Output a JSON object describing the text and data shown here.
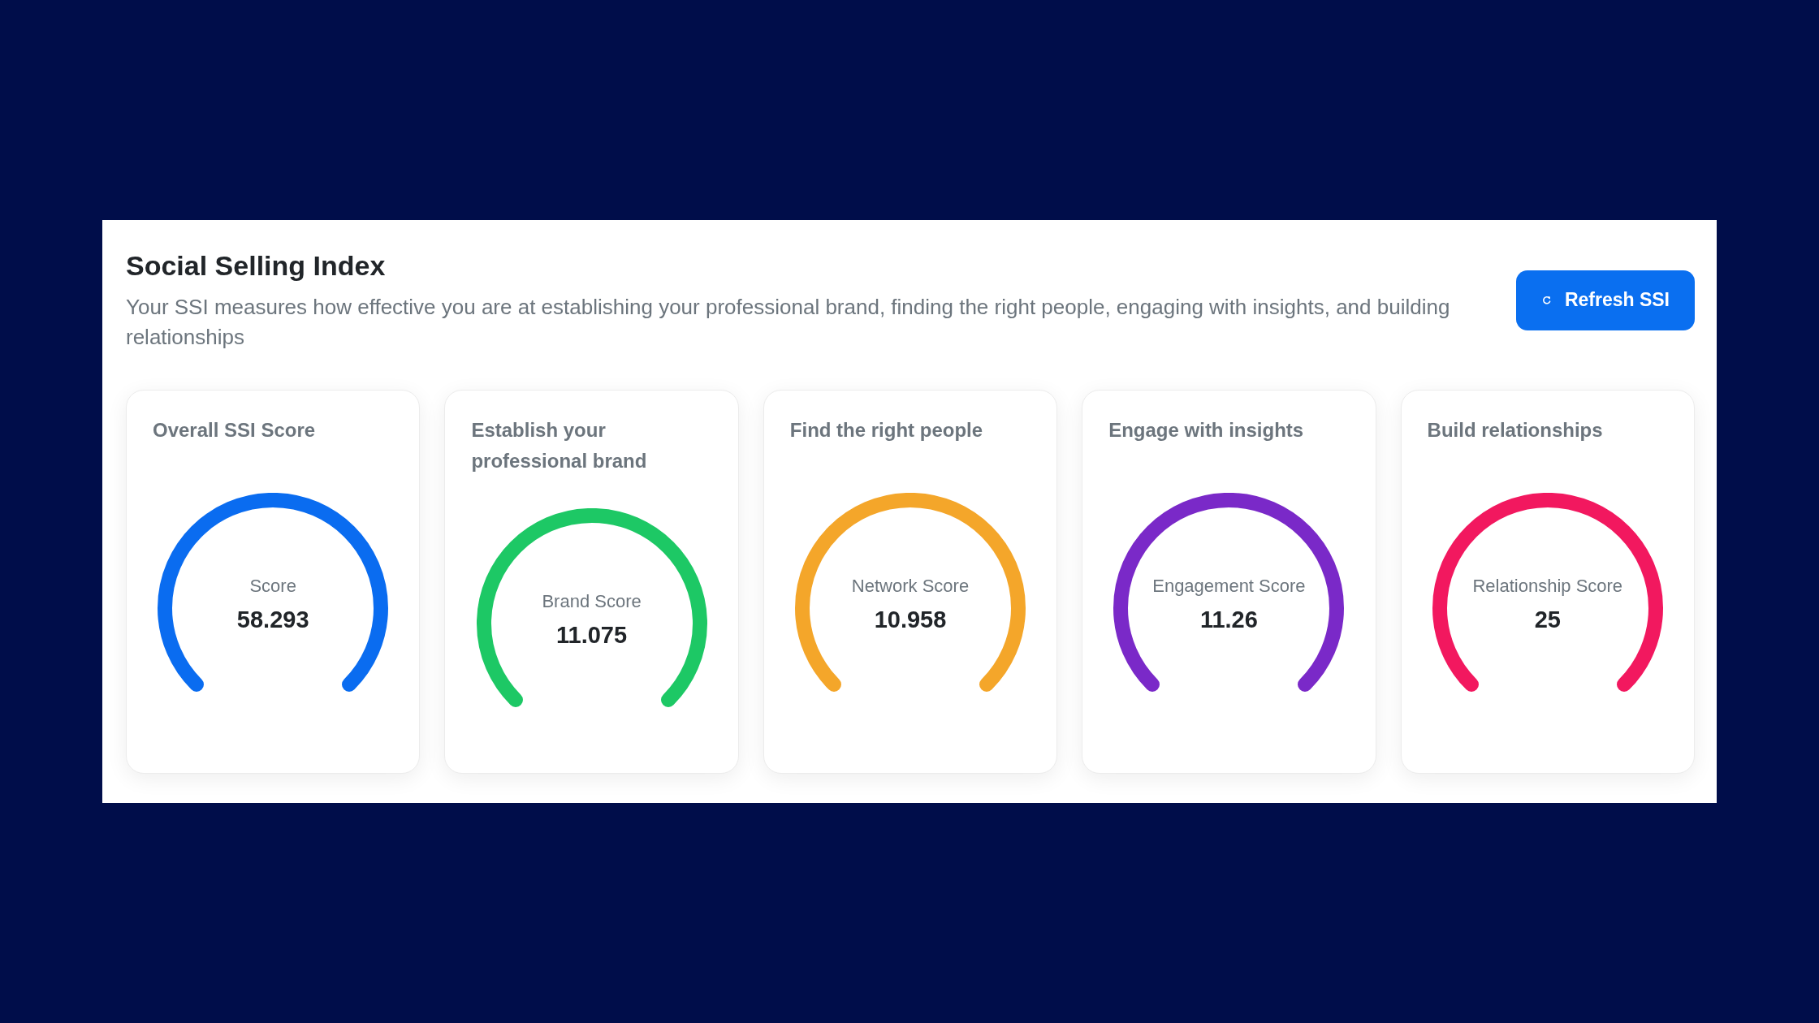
{
  "header": {
    "title": "Social Selling Index",
    "description": "Your SSI measures how effective you are at establishing your professional brand, finding the right people, engaging with insights, and building relationships",
    "refresh_button": {
      "label": "Refresh SSI"
    }
  },
  "score_cards": [
    {
      "title": "Overall SSI Score",
      "gauge_label": "Score",
      "value": "58.293",
      "color": "#0a6cf0"
    },
    {
      "title": "Establish your professional brand",
      "gauge_label": "Brand Score",
      "value": "11.075",
      "color": "#1dc865"
    },
    {
      "title": "Find the right people",
      "gauge_label": "Network Score",
      "value": "10.958",
      "color": "#f4a62a"
    },
    {
      "title": "Engage with insights",
      "gauge_label": "Engagement Score",
      "value": "11.26",
      "color": "#7a29c8"
    },
    {
      "title": "Build relationships",
      "gauge_label": "Relationship Score",
      "value": "25",
      "color": "#f2185f"
    }
  ]
}
